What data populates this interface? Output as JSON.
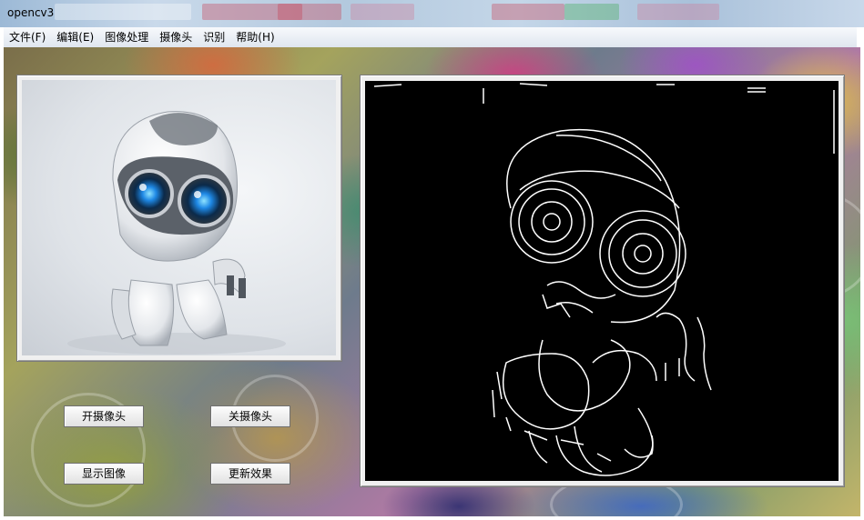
{
  "window": {
    "title": "opencv3"
  },
  "menubar": {
    "items": [
      {
        "label": "文件(F)"
      },
      {
        "label": "编辑(E)"
      },
      {
        "label": "图像处理"
      },
      {
        "label": "摄像头"
      },
      {
        "label": "识别"
      },
      {
        "label": "帮助(H)"
      }
    ]
  },
  "buttons": {
    "open_camera": "开摄像头",
    "close_camera": "关摄像头",
    "show_image": "显示图像",
    "update_effect": "更新效果"
  },
  "images": {
    "left": {
      "content": "robot-photo"
    },
    "right": {
      "content": "robot-canny-edges"
    }
  },
  "colors": {
    "edge_background": "#000000",
    "edge_lines": "#ffffff",
    "robot_eye": "#1e88e5"
  }
}
